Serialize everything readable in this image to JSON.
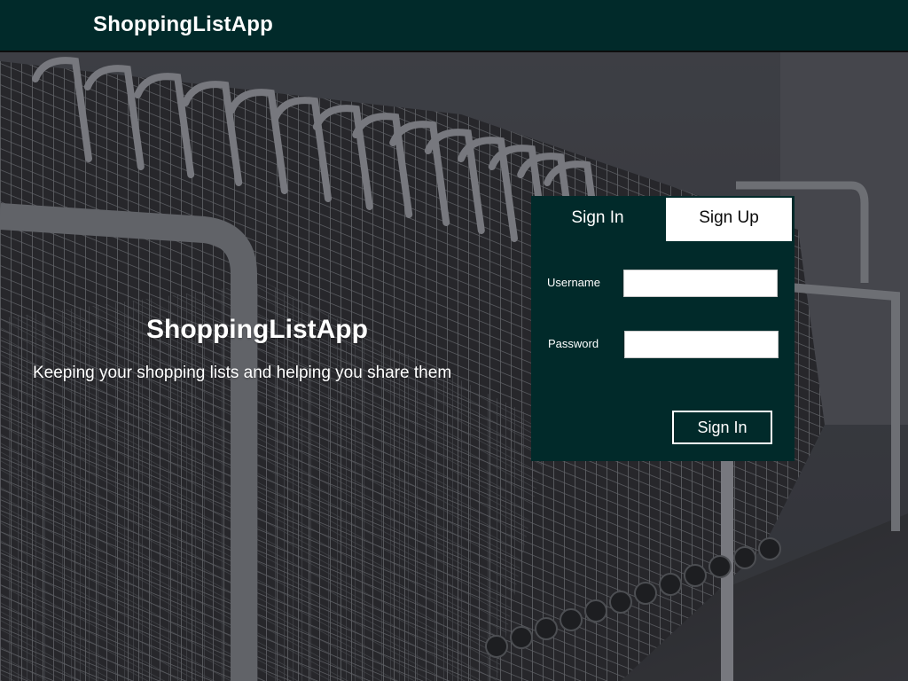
{
  "header": {
    "brand": "ShoppingListApp"
  },
  "hero": {
    "title": "ShoppingListApp",
    "tagline": "Keeping your shopping lists and helping you share them",
    "background": "shopping-carts-photo"
  },
  "auth": {
    "tabs": [
      {
        "label": "Sign In",
        "active": true
      },
      {
        "label": "Sign Up",
        "active": false
      }
    ],
    "username_label": "Username",
    "username_value": "",
    "password_label": "Password",
    "password_value": "",
    "submit_label": "Sign In"
  },
  "colors": {
    "primary": "#012a2a",
    "text_light": "#ffffff",
    "tab_inactive_bg": "#ffffff"
  }
}
